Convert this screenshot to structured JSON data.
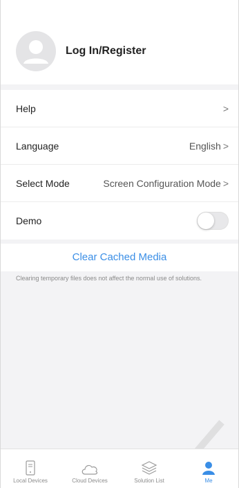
{
  "profile": {
    "login_label": "Log In/Register",
    "avatar_icon": "user-avatar-icon"
  },
  "settings": {
    "help": {
      "label": "Help",
      "chevron": ">"
    },
    "language": {
      "label": "Language",
      "value": "English",
      "chevron": ">"
    },
    "select_mode": {
      "label": "Select Mode",
      "value": "Screen Configuration Mode",
      "chevron": ">"
    },
    "demo": {
      "label": "Demo",
      "enabled": false
    }
  },
  "clear_cache": {
    "label": "Clear Cached Media",
    "note": "Clearing temporary files does not affect the normal use of solutions."
  },
  "tabs": [
    {
      "label": "Local Devices",
      "icon": "phone-device-icon",
      "active": false
    },
    {
      "label": "Cloud Devices",
      "icon": "cloud-icon",
      "active": false
    },
    {
      "label": "Solution List",
      "icon": "layers-icon",
      "active": false
    },
    {
      "label": "Me",
      "icon": "person-icon",
      "active": true
    }
  ],
  "colors": {
    "accent": "#3a8ee6",
    "background": "#f3f3f5",
    "card": "#ffffff",
    "muted_text": "#8a8a8a"
  }
}
